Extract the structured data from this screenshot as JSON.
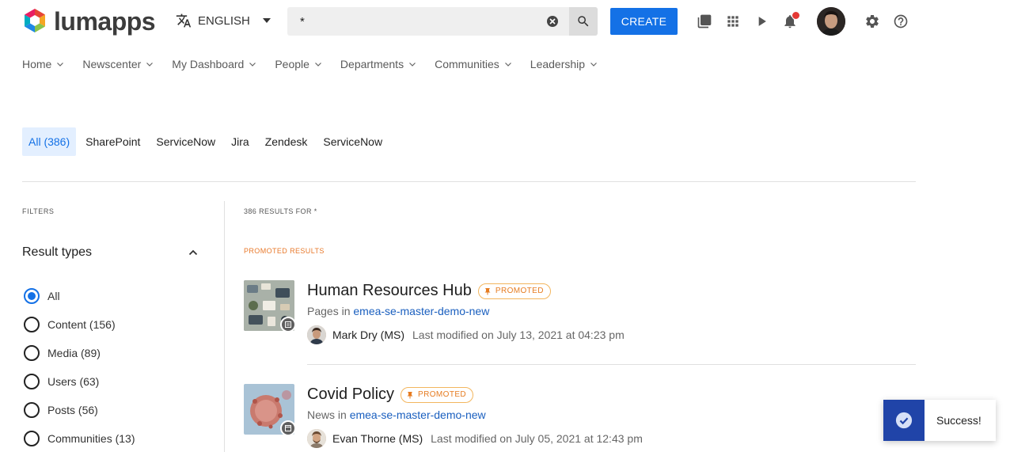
{
  "header": {
    "logo_text": "lumapps",
    "language": "ENGLISH",
    "search_value": "*",
    "create_label": "CREATE"
  },
  "nav": [
    {
      "label": "Home"
    },
    {
      "label": "Newscenter"
    },
    {
      "label": "My Dashboard"
    },
    {
      "label": "People"
    },
    {
      "label": "Departments"
    },
    {
      "label": "Communities"
    },
    {
      "label": "Leadership"
    }
  ],
  "tabs": [
    {
      "label": "All (386)",
      "active": true
    },
    {
      "label": "SharePoint"
    },
    {
      "label": "ServiceNow"
    },
    {
      "label": "Jira"
    },
    {
      "label": "Zendesk"
    },
    {
      "label": "ServiceNow"
    }
  ],
  "filters": {
    "title": "FILTERS",
    "result_types_label": "Result types",
    "options": [
      {
        "label": "All",
        "checked": true
      },
      {
        "label": "Content (156)"
      },
      {
        "label": "Media (89)"
      },
      {
        "label": "Users (63)"
      },
      {
        "label": "Posts (56)"
      },
      {
        "label": "Communities (13)"
      }
    ]
  },
  "results": {
    "count_label": "386 RESULTS FOR *",
    "promoted_label": "PROMOTED RESULTS",
    "items": [
      {
        "title": "Human Resources Hub",
        "badge": "PROMOTED",
        "type_prefix": "Pages in",
        "site": "emea-se-master-demo-new",
        "author": "Mark Dry (MS)",
        "modified": "Last modified on July 13, 2021 at 04:23 pm"
      },
      {
        "title": "Covid Policy",
        "badge": "PROMOTED",
        "type_prefix": "News in",
        "site": "emea-se-master-demo-new",
        "author": "Evan Thorne (MS)",
        "modified": "Last modified on July 05, 2021 at 12:43 pm"
      }
    ]
  },
  "toast": {
    "message": "Success!"
  },
  "colors": {
    "primary": "#1471e6",
    "promoted": "#e67c21",
    "toast_icon_bg": "#2044a8",
    "notification": "#e53935"
  }
}
